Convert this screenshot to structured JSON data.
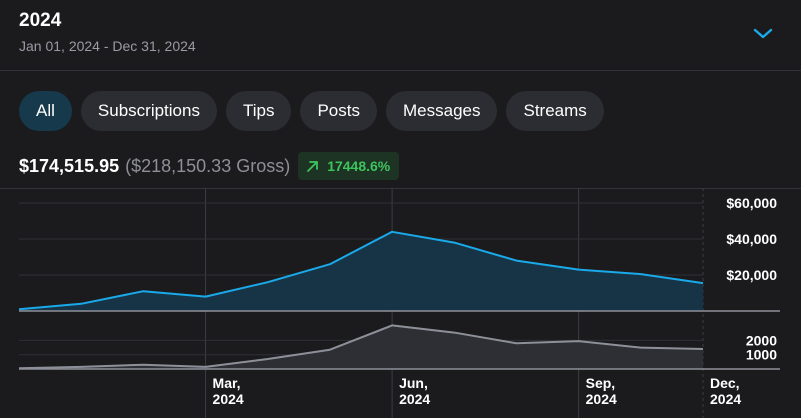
{
  "header": {
    "title": "2024",
    "date_range": "Jan 01, 2024 - Dec 31, 2024",
    "expand_icon": "chevron-down-icon"
  },
  "tabs": [
    {
      "label": "All",
      "active": true
    },
    {
      "label": "Subscriptions",
      "active": false
    },
    {
      "label": "Tips",
      "active": false
    },
    {
      "label": "Posts",
      "active": false
    },
    {
      "label": "Messages",
      "active": false
    },
    {
      "label": "Streams",
      "active": false
    }
  ],
  "summary": {
    "net": "$174,515.95",
    "gross": "($218,150.33 Gross)",
    "change": "17448.6%",
    "change_icon": "arrow-up-right-icon"
  },
  "colors": {
    "background": "#1b1b1e",
    "accent": "#1aa9e9",
    "secondary_line": "#8e9099",
    "positive": "#3ec45d",
    "active_tab": "#16394c"
  },
  "chart_data": [
    {
      "type": "area",
      "x": [
        "2024-01",
        "2024-02",
        "2024-03",
        "2024-04",
        "2024-05",
        "2024-06",
        "2024-07",
        "2024-08",
        "2024-09",
        "2024-10",
        "2024-11",
        "2024-12"
      ],
      "values": [
        1000,
        4000,
        11000,
        8000,
        16000,
        26000,
        44000,
        38000,
        28000,
        23000,
        20500,
        15500
      ],
      "ylim": [
        0,
        65000
      ],
      "yticks": [
        20000,
        40000,
        60000
      ],
      "ytick_labels": [
        "$20,000",
        "$40,000",
        "$60,000"
      ],
      "grid": true
    },
    {
      "type": "area",
      "x": [
        "2024-01",
        "2024-02",
        "2024-03",
        "2024-04",
        "2024-05",
        "2024-06",
        "2024-07",
        "2024-08",
        "2024-09",
        "2024-10",
        "2024-11",
        "2024-12"
      ],
      "values": [
        50,
        150,
        300,
        150,
        700,
        1350,
        3050,
        2550,
        1800,
        1950,
        1500,
        1400
      ],
      "ylim": [
        0,
        3500
      ],
      "yticks": [
        1000,
        2000
      ],
      "ytick_labels": [
        "1000",
        "2000"
      ],
      "xtick_labels": [
        {
          "month": "Mar,",
          "year": "2024"
        },
        {
          "month": "Jun,",
          "year": "2024"
        },
        {
          "month": "Sep,",
          "year": "2024"
        },
        {
          "month": "Dec,",
          "year": "2024"
        }
      ],
      "grid": true
    }
  ]
}
